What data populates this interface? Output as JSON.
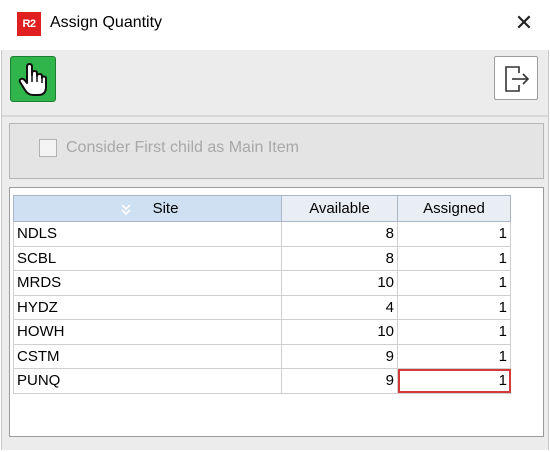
{
  "window": {
    "app_icon_text": "R2",
    "title": "Assign Quantity",
    "close_glyph": "✕"
  },
  "toolbar": {
    "assign_icon": "hand-pointer-icon",
    "assign_color": "#2fb54a",
    "exit_icon": "exit-icon"
  },
  "options": {
    "first_child_main_item": {
      "label": "Consider First child as Main Item",
      "checked": false,
      "enabled": false
    }
  },
  "table": {
    "columns": [
      "Site",
      "Available",
      "Assigned"
    ],
    "rows": [
      {
        "site": "NDLS",
        "available": "8",
        "assigned": "1"
      },
      {
        "site": "SCBL",
        "available": "8",
        "assigned": "1"
      },
      {
        "site": "MRDS",
        "available": "10",
        "assigned": "1"
      },
      {
        "site": "HYDZ",
        "available": "4",
        "assigned": "1"
      },
      {
        "site": "HOWH",
        "available": "10",
        "assigned": "1"
      },
      {
        "site": "CSTM",
        "available": "9",
        "assigned": "1"
      },
      {
        "site": "PUNQ",
        "available": "9",
        "assigned": "1"
      }
    ],
    "editing_row": 6
  }
}
